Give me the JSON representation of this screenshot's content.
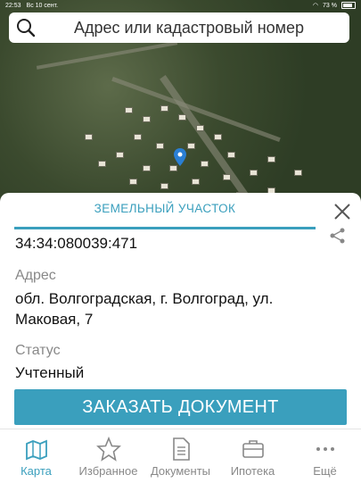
{
  "statusbar": {
    "time": "22:53",
    "date": "Вс 10 сент.",
    "battery": "73 %"
  },
  "search": {
    "placeholder": "Адрес или кадастровый номер"
  },
  "sheet": {
    "title": "ЗЕМЕЛЬНЫЙ УЧАСТОК",
    "cadastral_number": "34:34:080039:471",
    "address_label": "Адрес",
    "address_value": "обл. Волгоградская, г. Волгоград, ул. Маковая, 7",
    "status_label": "Статус",
    "status_value": "Учтенный",
    "order_button": "ЗАКАЗАТЬ ДОКУМЕНТ"
  },
  "tabs": [
    {
      "label": "Карта",
      "icon": "map-icon",
      "active": true
    },
    {
      "label": "Избранное",
      "icon": "star-icon",
      "active": false
    },
    {
      "label": "Документы",
      "icon": "document-icon",
      "active": false
    },
    {
      "label": "Ипотека",
      "icon": "briefcase-icon",
      "active": false
    },
    {
      "label": "Ещё",
      "icon": "more-icon",
      "active": false
    }
  ],
  "colors": {
    "accent": "#3a9fbd"
  }
}
